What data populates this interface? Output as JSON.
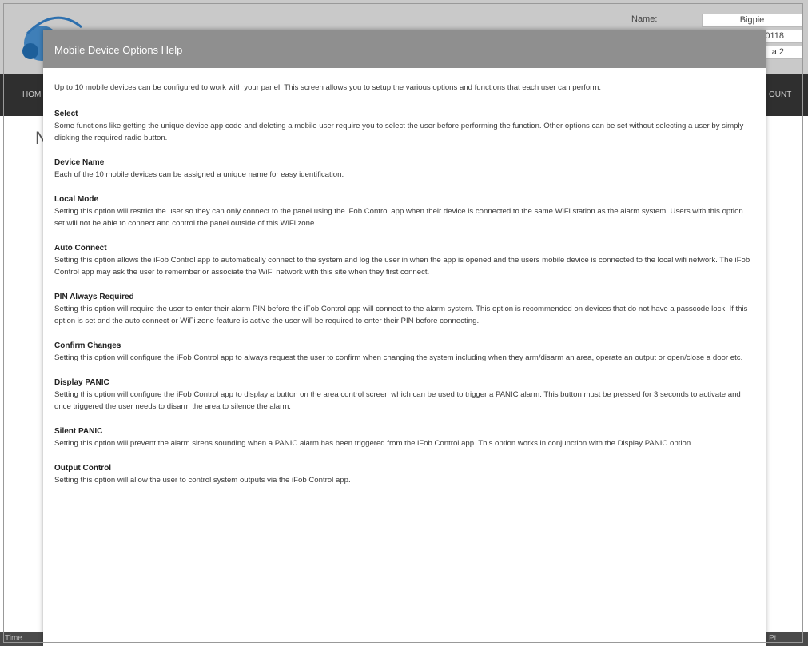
{
  "background": {
    "header": {
      "name_label": "Name:",
      "name_value": "Bigpie",
      "field_two_value": "0118",
      "field_three_value": "a 2"
    },
    "nav": {
      "left_item": "HOM",
      "right_item": "OUNT"
    },
    "page_heading": "N",
    "footer": {
      "left_text": "Time",
      "right_text": "Pt"
    }
  },
  "modal": {
    "title": "Mobile Device Options Help",
    "intro": "Up to 10 mobile devices can be configured to work with your panel. This screen allows you to setup the various options and functions that each user can perform.",
    "sections": [
      {
        "title": "Select",
        "text": "Some functions like getting the unique device app code and deleting a mobile user require you to select the user before performing the function. Other options can be set without selecting a user by simply clicking the required radio button."
      },
      {
        "title": "Device Name",
        "text": "Each of the 10 mobile devices can be assigned a unique name for easy identification."
      },
      {
        "title": "Local Mode",
        "text": "Setting this option will restrict the user so they can only connect to the panel using the iFob Control app when their device is connected to the same WiFi station as the alarm system. Users with this option set will not be able to connect and control the panel outside of this WiFi zone."
      },
      {
        "title": "Auto Connect",
        "text": "Setting this option allows the iFob Control app to automatically connect to the system and log the user in when the app is opened and the users mobile device is connected to the local wifi network. The iFob Control app may ask the user to remember or associate the WiFi network with this site when they first connect."
      },
      {
        "title": "PIN Always Required",
        "text": "Setting this option will require the user to enter their alarm PIN before the iFob Control app will connect to the alarm system. This option is recommended on devices that do not have a passcode lock. If this option is set and the auto connect or WiFi zone feature is active the user will be required to enter their PIN before connecting."
      },
      {
        "title": "Confirm Changes",
        "text": "Setting this option will configure the iFob Control app to always request the user to confirm when changing the system including when they arm/disarm an area, operate an output or open/close a door etc."
      },
      {
        "title": "Display PANIC",
        "text": "Setting this option will configure the iFob Control app to display a button on the area control screen which can be used to trigger a PANIC alarm. This button must be pressed for 3 seconds to activate and once triggered the user needs to disarm the area to silence the alarm."
      },
      {
        "title": "Silent PANIC",
        "text": "Setting this option will prevent the alarm sirens sounding when a PANIC alarm has been triggered from the iFob Control app. This option works in conjunction with the Display PANIC option."
      },
      {
        "title": "Output Control",
        "text": "Setting this option will allow the user to control system outputs via the iFob Control app."
      }
    ]
  },
  "colors": {
    "modal_title_bar": "#8f8f8f",
    "nav_bar": "#2f2f2f",
    "header_bg": "#c9c9c9"
  }
}
